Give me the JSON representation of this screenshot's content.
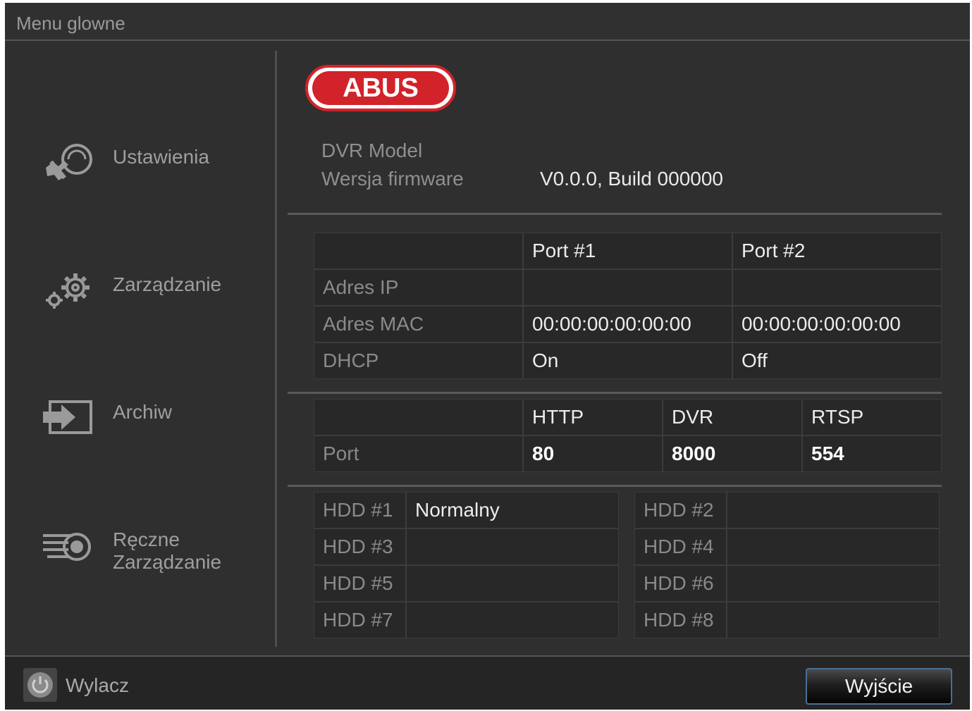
{
  "window": {
    "title": "Menu glowne"
  },
  "sidebar": {
    "items": [
      {
        "label": "Ustawienia",
        "icon": "settings-tools-icon"
      },
      {
        "label": "Zarządzanie",
        "icon": "gears-icon"
      },
      {
        "label": "Archiw",
        "icon": "export-arrow-icon"
      },
      {
        "label": "Ręczne\nZarządzanie",
        "icon": "manual-record-icon"
      }
    ]
  },
  "brand": {
    "logo_text": "ABUS",
    "color": "#d2232a"
  },
  "device_info": {
    "model_label": "DVR Model",
    "firmware_label": "Wersja firmware",
    "firmware_value": "V0.0.0, Build 000000"
  },
  "network": {
    "headers": [
      "Port #1",
      "Port #2"
    ],
    "rows": [
      {
        "label": "Adres IP",
        "values": [
          "",
          ""
        ]
      },
      {
        "label": "Adres MAC",
        "values": [
          "00:00:00:00:00:00",
          "00:00:00:00:00:00"
        ]
      },
      {
        "label": "DHCP",
        "values": [
          "On",
          "Off"
        ]
      }
    ]
  },
  "ports": {
    "headers": [
      "HTTP",
      "DVR",
      "RTSP"
    ],
    "row_label": "Port",
    "values": [
      "80",
      "8000",
      "554"
    ]
  },
  "hdd": [
    {
      "label": "HDD #1",
      "status": "Normalny"
    },
    {
      "label": "HDD #2",
      "status": ""
    },
    {
      "label": "HDD #3",
      "status": ""
    },
    {
      "label": "HDD #4",
      "status": ""
    },
    {
      "label": "HDD #5",
      "status": ""
    },
    {
      "label": "HDD #6",
      "status": ""
    },
    {
      "label": "HDD #7",
      "status": ""
    },
    {
      "label": "HDD #8",
      "status": ""
    }
  ],
  "footer": {
    "power_label": "Wylacz",
    "power_icon": "power-icon",
    "exit_label": "Wyjście"
  }
}
